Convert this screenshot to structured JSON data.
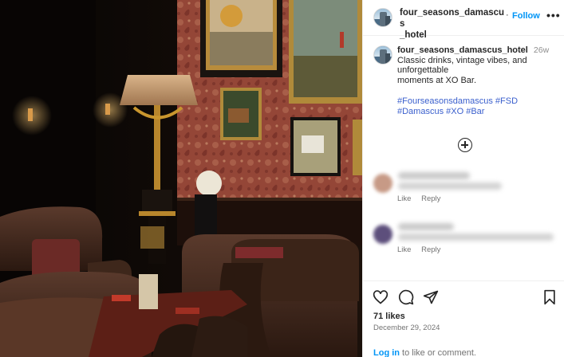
{
  "post": {
    "username": "four_seasons_damascus_hotel",
    "header_username_line1": "four_seasons_damascus",
    "header_username_line2": "_hotel",
    "separator": "·",
    "follow_label": "Follow",
    "more_icon": "more-options-icon",
    "caption": {
      "username": "four_seasons_damascus_hotel",
      "time": "26w",
      "line1": "Classic drinks, vintage vibes, and",
      "line2": "unforgettable",
      "line3": "moments at XO Bar.",
      "hashtags_line1": "#Fourseasonsdamascus #FSD",
      "hashtags_line2": "#Damascus #XO #Bar"
    },
    "load_more_icon": "add-circle-icon",
    "comments": [
      {
        "like_label": "Like",
        "reply_label": "Reply"
      },
      {
        "like_label": "Like",
        "reply_label": "Reply"
      }
    ],
    "actions": {
      "like_icon": "heart-icon",
      "comment_icon": "comment-icon",
      "share_icon": "send-icon",
      "save_icon": "bookmark-icon"
    },
    "likes": "71 likes",
    "date": "December 29, 2024",
    "login_link": "Log in",
    "login_text": " to like or comment."
  },
  "colors": {
    "link_blue": "#0095f6",
    "hashtag_blue": "#3a5fcd",
    "muted_gray": "#737373",
    "wallpaper": "#b0564a"
  }
}
